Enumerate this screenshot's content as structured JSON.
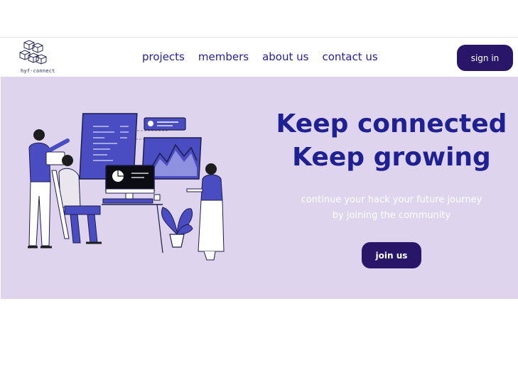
{
  "brand": {
    "logo_text": "hyf-connect",
    "logo_icon": "hexagon-cubes-icon"
  },
  "nav": {
    "links": [
      "projects",
      "members",
      "about us",
      "contact us"
    ],
    "sign_in": "sign in"
  },
  "hero": {
    "headline_line1": "Keep connected",
    "headline_line2": "Keep growing",
    "subtext_line1": "continue your hack your future journey",
    "subtext_line2": "by joining the community",
    "cta": "join us",
    "illustration": "team-collaboration-illustration"
  },
  "colors": {
    "primary": "#2a1669",
    "accent": "#24209a",
    "hero_bg": "#ded4ed",
    "illustration_blue": "#4a4dc2"
  }
}
